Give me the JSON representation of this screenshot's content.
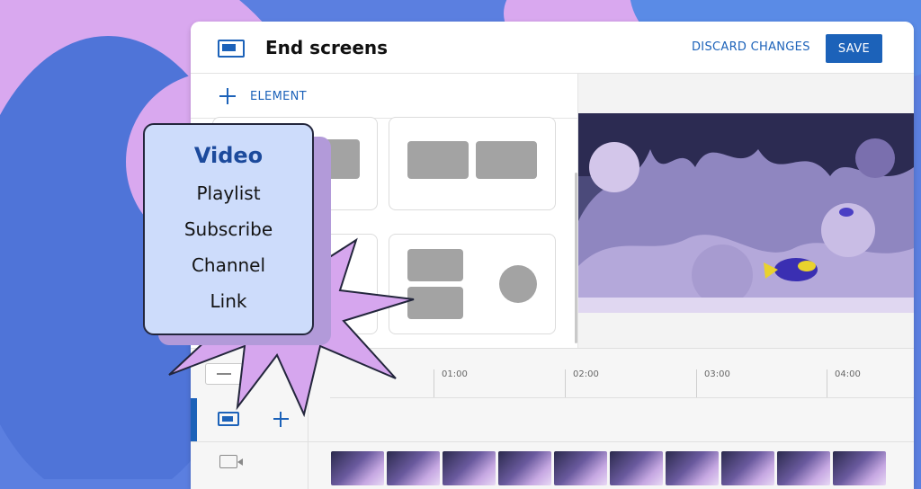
{
  "header": {
    "title": "End screens",
    "discard_label": "DISCARD CHANGES",
    "save_label": "SAVE"
  },
  "toolbar": {
    "add_element_label": "ELEMENT"
  },
  "element_menu": {
    "items": [
      "Video",
      "Playlist",
      "Subscribe",
      "Channel",
      "Link"
    ],
    "selected": "Video"
  },
  "timeline": {
    "ticks": [
      "01:00",
      "02:00",
      "03:00",
      "04:00"
    ]
  },
  "colors": {
    "accent": "#1c62b9",
    "popup_background": "#cddcfb",
    "burst_fill": "#d6a6ee"
  },
  "icons": [
    "end-screen-icon",
    "plus-icon",
    "zoom-out-icon",
    "camera-icon"
  ]
}
